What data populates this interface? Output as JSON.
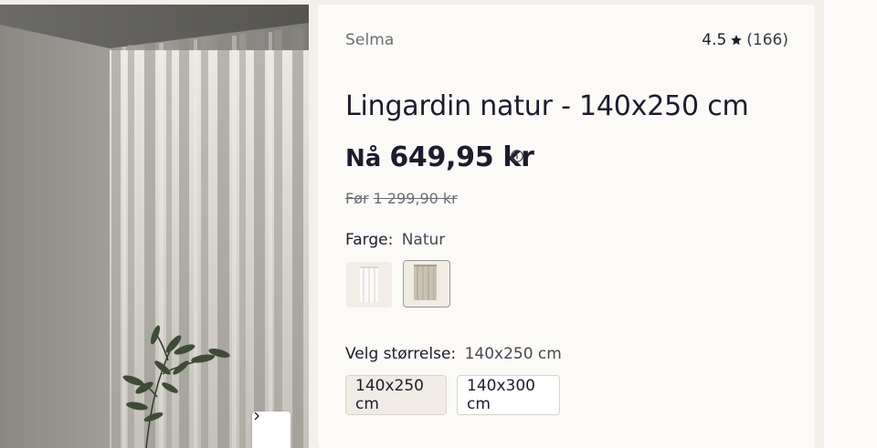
{
  "gallery": {
    "next_icon": "chevron-right-icon"
  },
  "product": {
    "brand": "Selma",
    "rating": {
      "score": "4.5",
      "star_icon": "star-icon",
      "count": "(166)"
    },
    "title": "Lingardin natur - 140x250 cm",
    "price": {
      "prefix": "Nå",
      "current": "649,95 kr",
      "info_icon": "info-icon",
      "old_prefix": "Før",
      "old": "1 299,90 kr"
    },
    "color": {
      "label": "Farge:",
      "value": "Natur",
      "swatches": [
        "white-curtain-swatch",
        "natural-curtain-swatch"
      ]
    },
    "size": {
      "label": "Velg størrelse:",
      "value": "140x250 cm",
      "options": [
        "140x250 cm",
        "140x300 cm"
      ],
      "selected_index": 0
    }
  },
  "colors": {
    "text": "#1f1b2d",
    "muted": "#6f6c76",
    "panel": "#fbfaf7",
    "page": "#f4efe8",
    "selected_bg": "#f0ebe4"
  }
}
